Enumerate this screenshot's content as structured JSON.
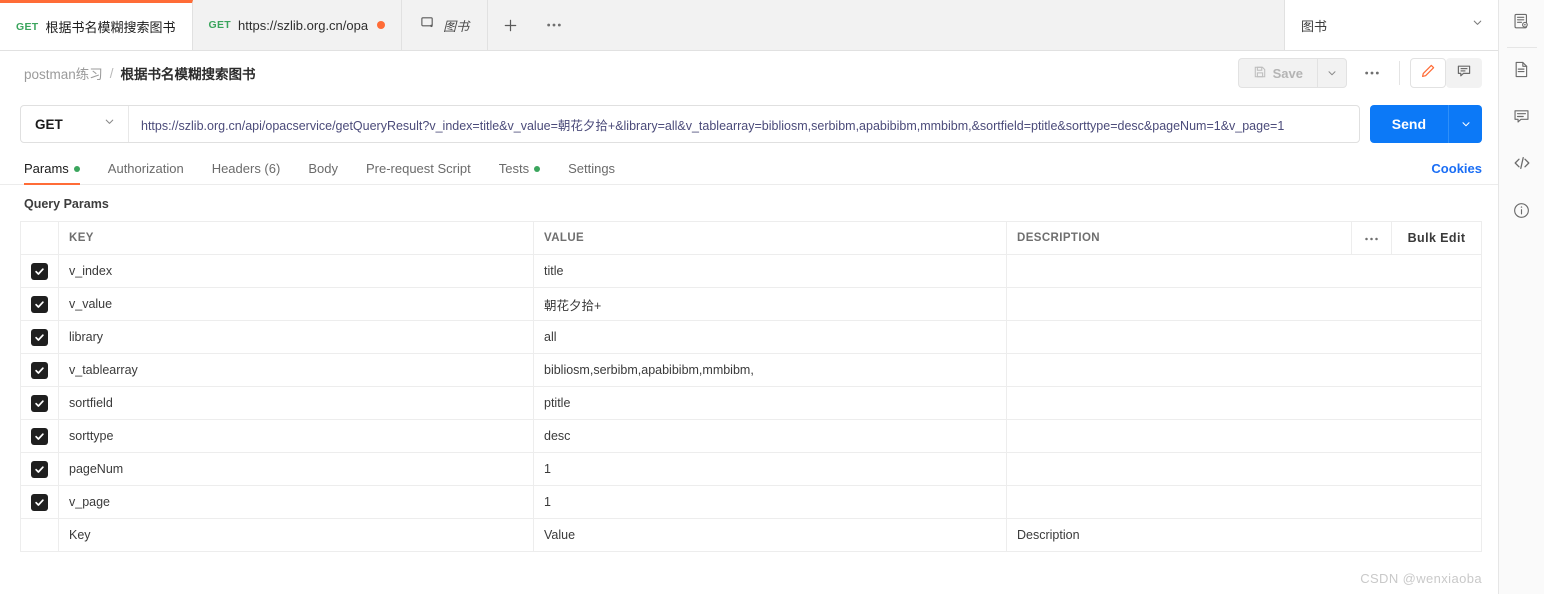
{
  "tabstrip": {
    "tabs": [
      {
        "method": "GET",
        "title": "根据书名模糊搜索图书",
        "active": true,
        "dirty": false
      },
      {
        "method": "GET",
        "title": "https://szlib.org.cn/opa",
        "active": false,
        "dirty": true
      }
    ],
    "env_tab": {
      "name": "图书",
      "icon": "monitor-icon"
    },
    "new_tab_label": "+",
    "more_label": "000",
    "env_selector": {
      "label": "图书",
      "chevron": "chevron-down-icon"
    }
  },
  "header": {
    "breadcrumb": {
      "parent": "postman练习",
      "separator": "/",
      "current": "根据书名模糊搜索图书"
    },
    "save_label": "Save",
    "save_caret": "chevron-down-icon",
    "more_label": "000",
    "edit_icon": "pencil-icon",
    "comment_icon": "comment-icon"
  },
  "request": {
    "method": "GET",
    "method_caret": "chevron-down-icon",
    "url": "https://szlib.org.cn/api/opacservice/getQueryResult?v_index=title&v_value=朝花夕拾+&library=all&v_tablearray=bibliosm,serbibm,apabibibm,mmbibm,&sortfield=ptitle&sorttype=desc&pageNum=1&v_page=1",
    "send_label": "Send",
    "send_caret": "chevron-down-icon"
  },
  "request_tabs": [
    {
      "label": "Params",
      "active": true,
      "dot": true
    },
    {
      "label": "Authorization",
      "active": false,
      "dot": false
    },
    {
      "label": "Headers (6)",
      "active": false,
      "dot": false
    },
    {
      "label": "Body",
      "active": false,
      "dot": false
    },
    {
      "label": "Pre-request Script",
      "active": false,
      "dot": false
    },
    {
      "label": "Tests",
      "active": false,
      "dot": true
    },
    {
      "label": "Settings",
      "active": false,
      "dot": false
    }
  ],
  "cookies_label": "Cookies",
  "params": {
    "section_title": "Query Params",
    "columns": {
      "key": "KEY",
      "value": "VALUE",
      "description": "DESCRIPTION"
    },
    "more_label": "000",
    "bulk_edit_label": "Bulk Edit",
    "rows": [
      {
        "checked": true,
        "key": "v_index",
        "value": "title",
        "description": ""
      },
      {
        "checked": true,
        "key": "v_value",
        "value": "朝花夕拾+",
        "description": ""
      },
      {
        "checked": true,
        "key": "library",
        "value": "all",
        "description": ""
      },
      {
        "checked": true,
        "key": "v_tablearray",
        "value": "bibliosm,serbibm,apabibibm,mmbibm,",
        "description": ""
      },
      {
        "checked": true,
        "key": "sortfield",
        "value": "ptitle",
        "description": ""
      },
      {
        "checked": true,
        "key": "sorttype",
        "value": "desc",
        "description": ""
      },
      {
        "checked": true,
        "key": "pageNum",
        "value": "1",
        "description": ""
      },
      {
        "checked": true,
        "key": "v_page",
        "value": "1",
        "description": ""
      }
    ],
    "empty_row": {
      "key_placeholder": "Key",
      "value_placeholder": "Value",
      "description_placeholder": "Description"
    }
  },
  "right_rail": [
    {
      "icon": "doc-preview-icon"
    },
    {
      "icon": "document-icon"
    },
    {
      "icon": "comment-icon"
    },
    {
      "icon": "code-icon"
    },
    {
      "icon": "info-icon"
    }
  ],
  "watermark": "CSDN @wenxiaoba",
  "colors": {
    "accent": "#ff6c37",
    "send": "#0c79f7",
    "link": "#1a6ef5",
    "method_get": "#3ba55d"
  }
}
